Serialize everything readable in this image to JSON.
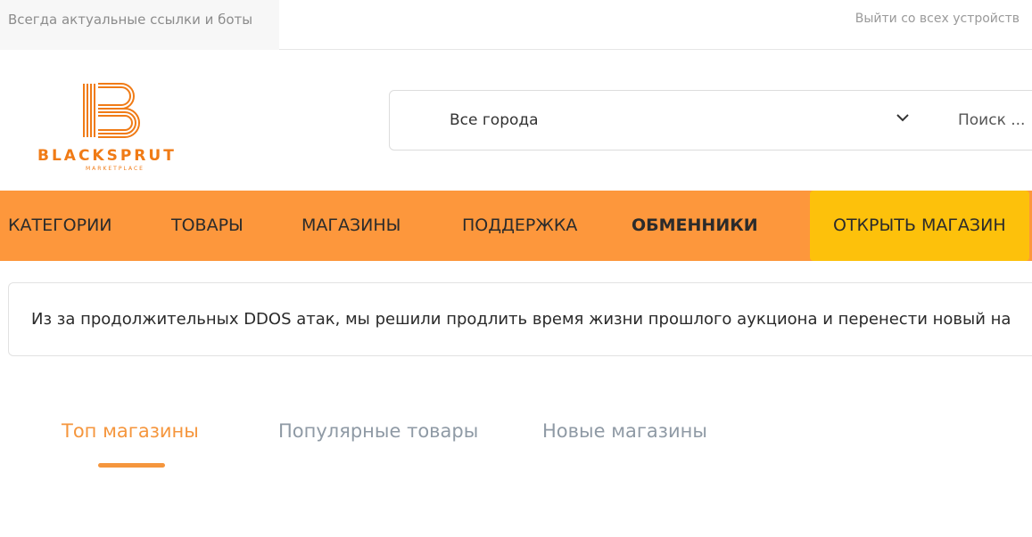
{
  "topbar": {
    "tagline": "Всегда актуальные ссылки и боты",
    "logout_all": "Выйти со всех устройств"
  },
  "logo": {
    "name": "BLACKSPRUT",
    "subtitle": "MARKETPLACE",
    "brand_color": "#f07b16"
  },
  "search": {
    "city_value": "Все города",
    "placeholder": "Поиск ..."
  },
  "nav": {
    "items": [
      {
        "label": "КАТЕГОРИИ"
      },
      {
        "label": "ТОВАРЫ"
      },
      {
        "label": "МАГАЗИНЫ"
      },
      {
        "label": "ПОДДЕРЖКА"
      },
      {
        "label": "ОБМЕННИКИ"
      }
    ],
    "open_shop": "ОТКРЫТЬ МАГАЗИН",
    "nav_color": "#fd973c",
    "cta_color": "#fdc10b"
  },
  "notice": {
    "text": "Из за продолжительных DDOS атак, мы решили продлить время жизни прошлого аукциона и перенести новый на"
  },
  "tabs": [
    {
      "label": "Топ магазины",
      "active": true
    },
    {
      "label": "Популярные товары",
      "active": false
    },
    {
      "label": "Новые магазины",
      "active": false
    }
  ]
}
